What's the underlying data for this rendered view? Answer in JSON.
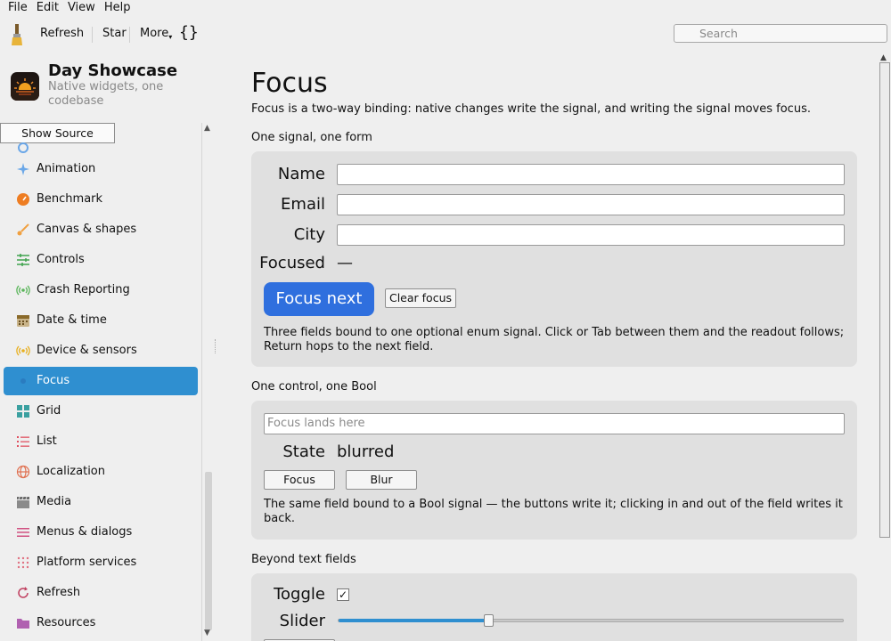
{
  "menu": [
    "File",
    "Edit",
    "View",
    "Help"
  ],
  "toolbar": {
    "refresh_label": "Refresh",
    "star_label": "Star",
    "more_label": "More",
    "braces_label": "{}",
    "search_placeholder": "Search"
  },
  "sidebar": {
    "app_title": "Day Showcase",
    "app_subtitle": "Native widgets, one codebase",
    "show_source_label": "Show Source",
    "items": [
      {
        "label": "Animation",
        "icon": "sparkles-icon",
        "color": "#6aa7e8"
      },
      {
        "label": "Benchmark",
        "icon": "gauge-icon",
        "color": "#ee7d22"
      },
      {
        "label": "Canvas & shapes",
        "icon": "brush-icon",
        "color": "#f0a040"
      },
      {
        "label": "Controls",
        "icon": "sliders-icon",
        "color": "#3fa34d"
      },
      {
        "label": "Crash Reporting",
        "icon": "broadcast-icon",
        "color": "#5ab55a"
      },
      {
        "label": "Date & time",
        "icon": "calendar-icon",
        "color": "#8a6a2a"
      },
      {
        "label": "Device & sensors",
        "icon": "sensor-icon",
        "color": "#e8b020"
      },
      {
        "label": "Focus",
        "icon": "focus-icon",
        "color": "#2f8fd0",
        "selected": true
      },
      {
        "label": "Grid",
        "icon": "grid-icon",
        "color": "#3aa0a0"
      },
      {
        "label": "List",
        "icon": "list-icon",
        "color": "#e05060"
      },
      {
        "label": "Localization",
        "icon": "globe-icon",
        "color": "#e07050"
      },
      {
        "label": "Media",
        "icon": "clapper-icon",
        "color": "#6a6a6a"
      },
      {
        "label": "Menus & dialogs",
        "icon": "menu-icon",
        "color": "#d05080"
      },
      {
        "label": "Platform services",
        "icon": "dots-grid-icon",
        "color": "#e07080"
      },
      {
        "label": "Refresh",
        "icon": "refresh-icon",
        "color": "#c04060"
      },
      {
        "label": "Resources",
        "icon": "folder-icon",
        "color": "#b060b0"
      }
    ]
  },
  "main": {
    "title": "Focus",
    "description": "Focus is a two-way binding: native changes write the signal, and writing the signal moves focus.",
    "section1": {
      "label": "One signal, one form",
      "fields": [
        {
          "label": "Name",
          "value": ""
        },
        {
          "label": "Email",
          "value": ""
        },
        {
          "label": "City",
          "value": ""
        }
      ],
      "focused_label": "Focused",
      "focused_value": "—",
      "focus_next_label": "Focus next",
      "clear_focus_label": "Clear focus",
      "note": "Three fields bound to one optional enum signal. Click or Tab between them and the readout follows; Return hops to the next field."
    },
    "section2": {
      "label": "One control, one Bool",
      "field_placeholder": "Focus lands here",
      "state_label": "State",
      "state_value": "blurred",
      "focus_label": "Focus",
      "blur_label": "Blur",
      "note": "The same field bound to a Bool signal — the buttons write it; clicking in and out of the field writes it back."
    },
    "section3": {
      "label": "Beyond text fields",
      "toggle_label": "Toggle",
      "toggle_checked": "✓",
      "slider_label": "Slider",
      "slider_fraction": 0.3
    }
  },
  "colors": {
    "accent": "#2f8fd0",
    "primary_button": "#2f6fde",
    "card_bg": "#e0e0e0",
    "window_bg": "#efefef"
  }
}
